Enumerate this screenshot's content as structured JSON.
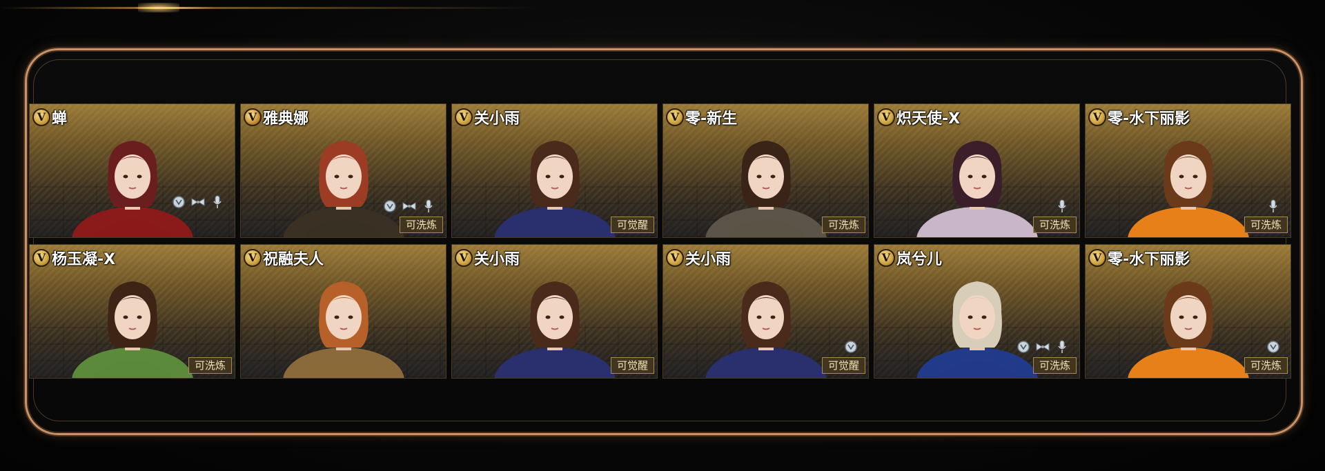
{
  "colors": {
    "frame_border": "#c8936a",
    "card_gold_top": "#9a7a38",
    "badge_gold": "#d3a844",
    "tag_text": "#f1e2b8"
  },
  "cards": [
    {
      "name": "蝉",
      "tag": "",
      "badge": "V",
      "icons": [
        "emblem-icon",
        "bow-icon",
        "mic-icon"
      ],
      "hair": "#6b1e1e",
      "outfit": "#8b1a1a"
    },
    {
      "name": "雅典娜",
      "tag": "可洗炼",
      "badge": "V",
      "badge_special": true,
      "icons": [
        "emblem-icon",
        "bow-icon",
        "mic-icon"
      ],
      "hair": "#9c3c24",
      "outfit": "#3a3024"
    },
    {
      "name": "关小雨",
      "tag": "可觉醒",
      "badge": "V",
      "icons": [],
      "hair": "#4a2a1a",
      "outfit": "#2a2f6e"
    },
    {
      "name": "零-新生",
      "tag": "可洗炼",
      "badge": "V",
      "icons": [],
      "hair": "#3a2418",
      "outfit": "#5a5548"
    },
    {
      "name": "炽天使-X",
      "tag": "可洗炼",
      "badge": "V",
      "icons": [
        "mic-icon"
      ],
      "hair": "#3a1e2a",
      "outfit": "#c9b6c8"
    },
    {
      "name": "零-水下丽影",
      "tag": "可洗炼",
      "badge": "V",
      "icons": [
        "mic-icon"
      ],
      "hair": "#6a3a1a",
      "outfit": "#e8801a"
    },
    {
      "name": "杨玉凝-X",
      "tag": "可洗炼",
      "badge": "V",
      "icons": [],
      "hair": "#3e2414",
      "outfit": "#5a8a3a"
    },
    {
      "name": "祝融夫人",
      "tag": "",
      "badge": "V",
      "icons": [],
      "hair": "#b8602a",
      "outfit": "#8a6a3a"
    },
    {
      "name": "关小雨",
      "tag": "可觉醒",
      "badge": "V",
      "icons": [],
      "hair": "#4a2a1a",
      "outfit": "#2a2f6e"
    },
    {
      "name": "关小雨",
      "tag": "可觉醒",
      "badge": "V",
      "icons": [
        "emblem-icon"
      ],
      "hair": "#4a2a1a",
      "outfit": "#2a2f6e"
    },
    {
      "name": "岚兮儿",
      "tag": "可洗炼",
      "badge": "V",
      "icons": [
        "emblem-icon",
        "bow-icon",
        "mic-icon"
      ],
      "hair": "#d8cdb8",
      "outfit": "#223a8a"
    },
    {
      "name": "零-水下丽影",
      "tag": "可洗炼",
      "badge": "V",
      "icons": [
        "emblem-icon"
      ],
      "hair": "#6a3a1a",
      "outfit": "#e8801a"
    }
  ]
}
